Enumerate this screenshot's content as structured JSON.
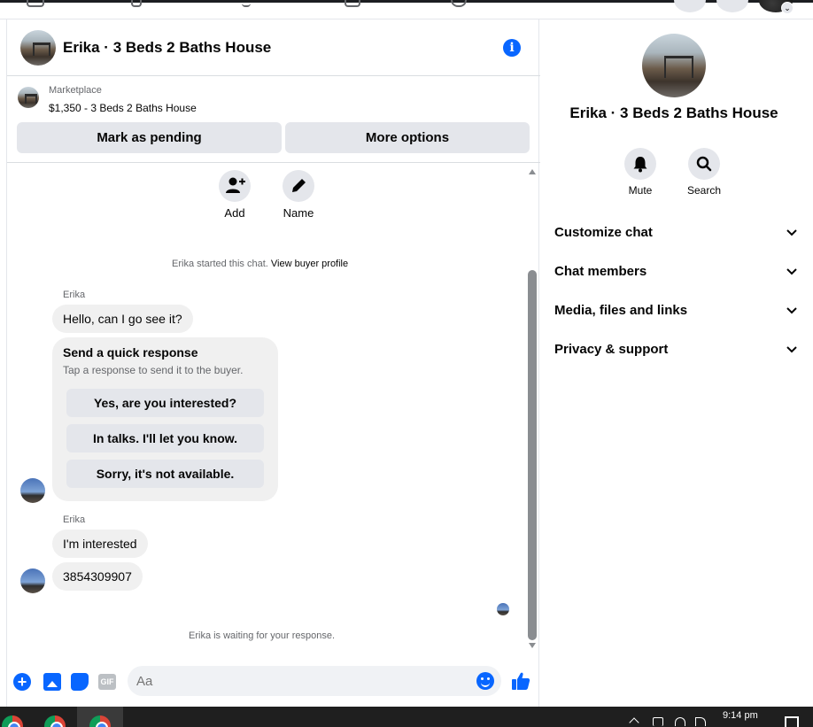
{
  "header": {
    "title": "Erika · 3 Beds 2 Baths House",
    "info_icon": "info-icon",
    "info_glyph": "i"
  },
  "marketplace": {
    "label": "Marketplace",
    "listing": "$1,350 - 3 Beds 2 Baths House",
    "mark_pending": "Mark as pending",
    "more_options": "More options"
  },
  "actions": {
    "add": "Add",
    "name": "Name"
  },
  "conversation": {
    "started_text": "Erika started this chat.",
    "view_profile": "View buyer profile",
    "sender": "Erika",
    "msg1": "Hello, can I go see it?",
    "quick_title": "Send a quick response",
    "quick_sub": "Tap a response to send it to the buyer.",
    "quick_responses": [
      "Yes, are you interested?",
      "In talks. I'll let you know.",
      "Sorry, it's not available."
    ],
    "sender2": "Erika",
    "msg2": "I'm interested",
    "msg3": "3854309907",
    "waiting": "Erika is waiting for your response."
  },
  "composer": {
    "placeholder": "Aa",
    "gif_label": "GIF",
    "plus_glyph": "+"
  },
  "side": {
    "title": "Erika · 3 Beds 2 Baths House",
    "mute": "Mute",
    "search": "Search",
    "rows": [
      "Customize chat",
      "Chat members",
      "Media, files and links",
      "Privacy & support"
    ]
  },
  "taskbar": {
    "time": "9:14 pm"
  },
  "colors": {
    "accent": "#0866ff",
    "bubble": "#f0f0f0",
    "button": "#e4e6eb",
    "secondary_text": "#65676b"
  }
}
